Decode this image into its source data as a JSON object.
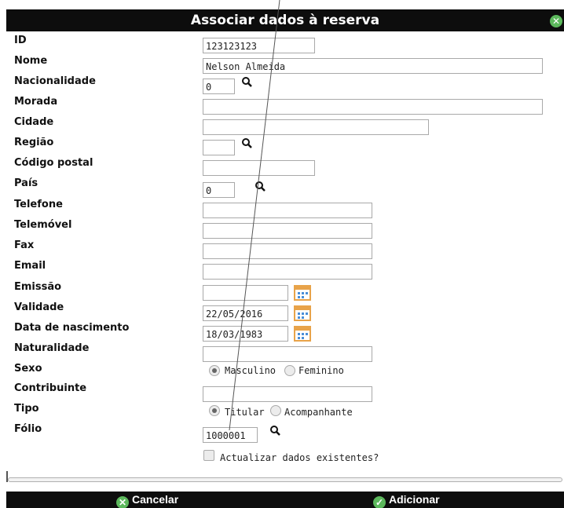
{
  "dialog": {
    "title": "Associar dados à reserva",
    "close_icon": "close-icon"
  },
  "fields": {
    "id": {
      "label": "ID",
      "value": "123123123"
    },
    "nome": {
      "label": "Nome",
      "value": "Nelson Almeida"
    },
    "nacionalidade": {
      "label": "Nacionalidade",
      "value": "0"
    },
    "morada": {
      "label": "Morada",
      "value": ""
    },
    "cidade": {
      "label": "Cidade",
      "value": ""
    },
    "regiao": {
      "label": "Região",
      "value": ""
    },
    "codigo_postal": {
      "label": "Código postal",
      "value": ""
    },
    "pais": {
      "label": "País",
      "value": "0"
    },
    "telefone": {
      "label": "Telefone",
      "value": ""
    },
    "telemovel": {
      "label": "Telemóvel",
      "value": ""
    },
    "fax": {
      "label": "Fax",
      "value": ""
    },
    "email": {
      "label": "Email",
      "value": ""
    },
    "emissao": {
      "label": "Emissão",
      "value": ""
    },
    "validade": {
      "label": "Validade",
      "value": "22/05/2016"
    },
    "data_nascimento": {
      "label": "Data de nascimento",
      "value": "18/03/1983"
    },
    "naturalidade": {
      "label": "Naturalidade",
      "value": ""
    },
    "sexo": {
      "label": "Sexo",
      "options": [
        "Masculino",
        "Feminino"
      ],
      "selected": "Masculino"
    },
    "contribuinte": {
      "label": "Contribuinte",
      "value": ""
    },
    "tipo": {
      "label": "Tipo",
      "options": [
        "Titular",
        "Acompanhante"
      ],
      "selected": "Titular"
    },
    "folio": {
      "label": "Fólio",
      "value": "1000001"
    },
    "actualizar": {
      "label": "Actualizar dados existentes?",
      "checked": false
    }
  },
  "footer": {
    "cancel_label": "Cancelar",
    "add_label": "Adicionar"
  },
  "colors": {
    "title_bar": "#0d0d0d",
    "accent_green": "#5cb85c"
  }
}
